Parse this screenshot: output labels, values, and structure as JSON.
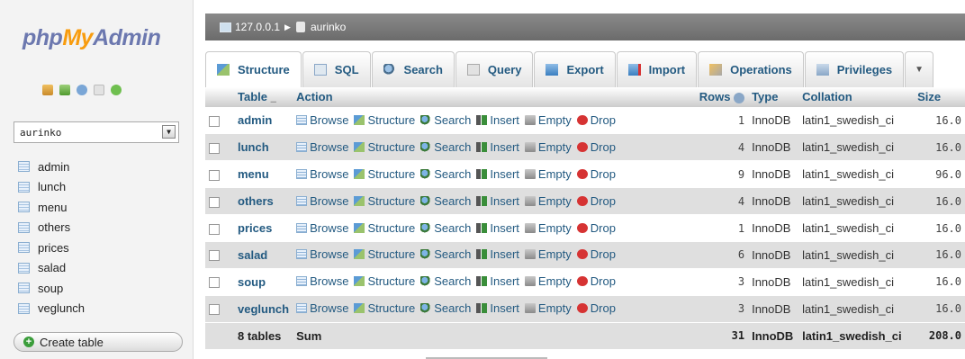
{
  "logo": {
    "php": "php",
    "my": "My",
    "admin": "Admin"
  },
  "left": {
    "quicklinks": [
      "home-icon",
      "logout-icon",
      "help-icon",
      "docs-icon",
      "reload-icon"
    ],
    "db_select": "aurinko",
    "tables": [
      "admin",
      "lunch",
      "menu",
      "others",
      "prices",
      "salad",
      "soup",
      "veglunch"
    ],
    "create_table": "Create table"
  },
  "breadcrumb": {
    "server": "127.0.0.1",
    "database": "aurinko"
  },
  "tabs": [
    {
      "label": "Structure",
      "icon": "structure-icon"
    },
    {
      "label": "SQL",
      "icon": "sql-icon"
    },
    {
      "label": "Search",
      "icon": "search-icon"
    },
    {
      "label": "Query",
      "icon": "query-icon"
    },
    {
      "label": "Export",
      "icon": "export-icon"
    },
    {
      "label": "Import",
      "icon": "import-icon"
    },
    {
      "label": "Operations",
      "icon": "operations-icon"
    },
    {
      "label": "Privileges",
      "icon": "privileges-icon"
    }
  ],
  "columns": {
    "table": "Table",
    "action": "Action",
    "rows": "Rows",
    "type": "Type",
    "collation": "Collation",
    "size": "Size"
  },
  "actions": {
    "browse": "Browse",
    "structure": "Structure",
    "search": "Search",
    "insert": "Insert",
    "empty": "Empty",
    "drop": "Drop"
  },
  "rows": [
    {
      "name": "admin",
      "rows": "1",
      "type": "InnoDB",
      "collation": "latin1_swedish_ci",
      "size": "16.0"
    },
    {
      "name": "lunch",
      "rows": "4",
      "type": "InnoDB",
      "collation": "latin1_swedish_ci",
      "size": "16.0"
    },
    {
      "name": "menu",
      "rows": "9",
      "type": "InnoDB",
      "collation": "latin1_swedish_ci",
      "size": "96.0"
    },
    {
      "name": "others",
      "rows": "4",
      "type": "InnoDB",
      "collation": "latin1_swedish_ci",
      "size": "16.0"
    },
    {
      "name": "prices",
      "rows": "1",
      "type": "InnoDB",
      "collation": "latin1_swedish_ci",
      "size": "16.0"
    },
    {
      "name": "salad",
      "rows": "6",
      "type": "InnoDB",
      "collation": "latin1_swedish_ci",
      "size": "16.0"
    },
    {
      "name": "soup",
      "rows": "3",
      "type": "InnoDB",
      "collation": "latin1_swedish_ci",
      "size": "16.0"
    },
    {
      "name": "veglunch",
      "rows": "3",
      "type": "InnoDB",
      "collation": "latin1_swedish_ci",
      "size": "16.0"
    }
  ],
  "footer": {
    "tables": "8 tables",
    "sum": "Sum",
    "rows": "31",
    "type": "InnoDB",
    "collation": "latin1_swedish_ci",
    "size": "208.0"
  },
  "colors": {
    "link": "#235a81",
    "accent_orange": "#f89c0e",
    "logo_blue": "#6c78af",
    "drop_red": "#d63333"
  }
}
